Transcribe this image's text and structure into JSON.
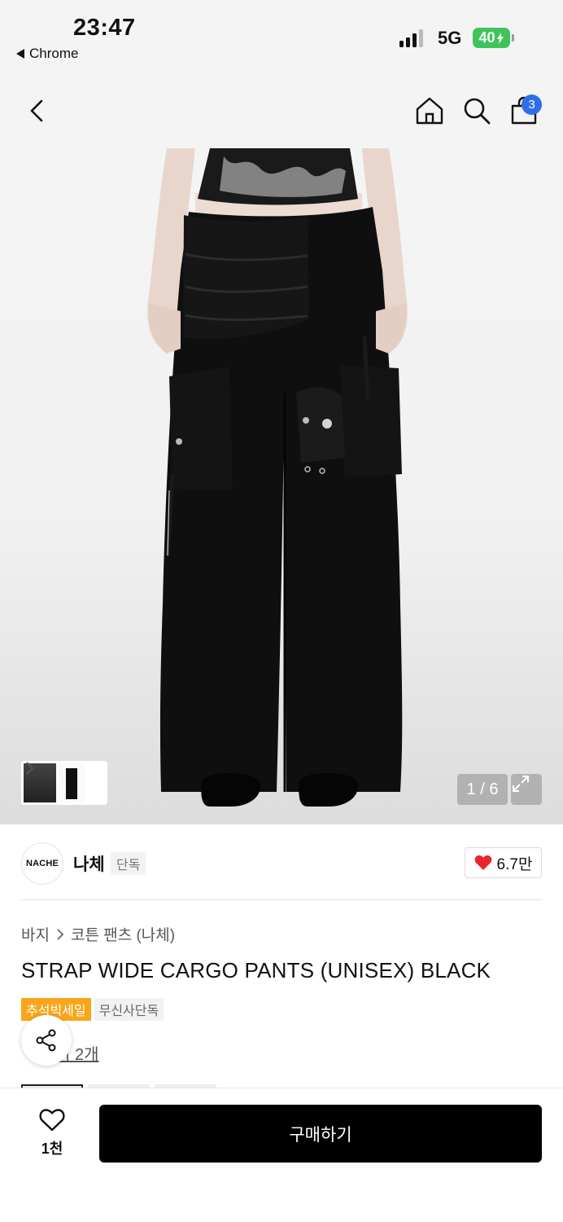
{
  "status_bar": {
    "time": "23:47",
    "back_app": "Chrome",
    "network": "5G",
    "battery": "40"
  },
  "nav": {
    "icons": [
      "back-icon",
      "home-icon",
      "search-icon",
      "cart-icon"
    ],
    "cart_count": "3"
  },
  "gallery": {
    "counter": "1 / 6"
  },
  "brand": {
    "logo_text": "NACHE",
    "name": "나체",
    "badge": "단독",
    "likes": "6.7만"
  },
  "product": {
    "breadcrumb": [
      "바지",
      "코튼 팬츠 (나체)"
    ],
    "title": "STRAP WIDE CARGO PANTS (UNISEX) BLACK",
    "tags": [
      "추석빅세일",
      "무신사단독"
    ],
    "review_link": "기 2개"
  },
  "bottom_bar": {
    "wish_count": "1천",
    "buy_label": "구매하기"
  },
  "colors": {
    "accent_blue": "#2f6fe6",
    "sale_orange": "#f8a61a",
    "heart_red": "#e8262c",
    "battery_green": "#3ec55a"
  }
}
